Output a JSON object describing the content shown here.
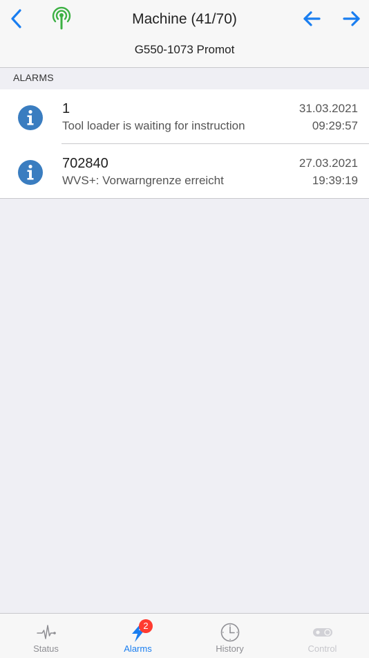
{
  "header": {
    "title": "Machine (41/70)",
    "subtitle": "G550-1073 Promot",
    "back_icon": "chevron-left-icon",
    "signal_icon": "antenna-signal-icon",
    "prev_icon": "arrow-left-icon",
    "next_icon": "arrow-right-icon"
  },
  "section": {
    "title": "ALARMS"
  },
  "alarms": [
    {
      "code": "1",
      "text": "Tool loader is waiting for instruction",
      "date": "31.03.2021",
      "time": "09:29:57",
      "icon": "info-icon"
    },
    {
      "code": "702840",
      "text": "WVS+: Vorwarngrenze erreicht",
      "date": "27.03.2021",
      "time": "19:39:19",
      "icon": "info-icon"
    }
  ],
  "tabs": [
    {
      "label": "Status",
      "icon": "pulse-icon",
      "active": false
    },
    {
      "label": "Alarms",
      "icon": "lightning-icon",
      "active": true,
      "badge": "2"
    },
    {
      "label": "History",
      "icon": "clock-icon",
      "active": false
    },
    {
      "label": "Control",
      "icon": "toggle-icon",
      "active": false,
      "disabled": true
    }
  ],
  "colors": {
    "accent": "#1a7ef0",
    "signal": "#3cb043",
    "info": "#3a7dc0",
    "badge": "#ff3b30",
    "tab_inactive": "#8e8e93",
    "tab_disabled": "#c7c7cc"
  }
}
